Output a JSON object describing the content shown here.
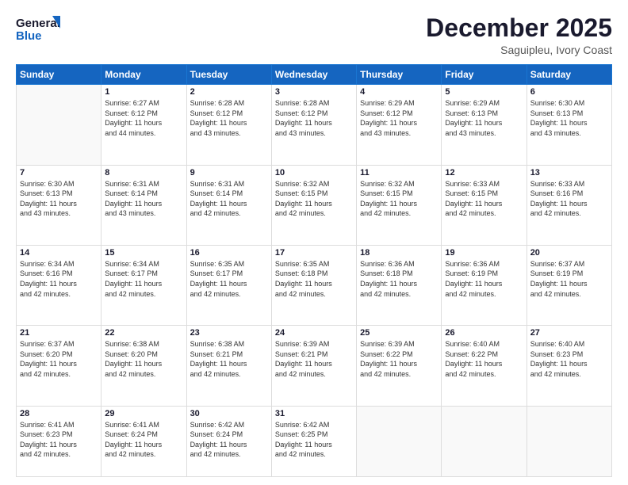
{
  "header": {
    "logo_general": "General",
    "logo_blue": "Blue",
    "month_year": "December 2025",
    "location": "Saguipleu, Ivory Coast"
  },
  "weekdays": [
    "Sunday",
    "Monday",
    "Tuesday",
    "Wednesday",
    "Thursday",
    "Friday",
    "Saturday"
  ],
  "weeks": [
    [
      {
        "day": "",
        "detail": ""
      },
      {
        "day": "1",
        "detail": "Sunrise: 6:27 AM\nSunset: 6:12 PM\nDaylight: 11 hours\nand 44 minutes."
      },
      {
        "day": "2",
        "detail": "Sunrise: 6:28 AM\nSunset: 6:12 PM\nDaylight: 11 hours\nand 43 minutes."
      },
      {
        "day": "3",
        "detail": "Sunrise: 6:28 AM\nSunset: 6:12 PM\nDaylight: 11 hours\nand 43 minutes."
      },
      {
        "day": "4",
        "detail": "Sunrise: 6:29 AM\nSunset: 6:12 PM\nDaylight: 11 hours\nand 43 minutes."
      },
      {
        "day": "5",
        "detail": "Sunrise: 6:29 AM\nSunset: 6:13 PM\nDaylight: 11 hours\nand 43 minutes."
      },
      {
        "day": "6",
        "detail": "Sunrise: 6:30 AM\nSunset: 6:13 PM\nDaylight: 11 hours\nand 43 minutes."
      }
    ],
    [
      {
        "day": "7",
        "detail": "Sunrise: 6:30 AM\nSunset: 6:13 PM\nDaylight: 11 hours\nand 43 minutes."
      },
      {
        "day": "8",
        "detail": "Sunrise: 6:31 AM\nSunset: 6:14 PM\nDaylight: 11 hours\nand 43 minutes."
      },
      {
        "day": "9",
        "detail": "Sunrise: 6:31 AM\nSunset: 6:14 PM\nDaylight: 11 hours\nand 42 minutes."
      },
      {
        "day": "10",
        "detail": "Sunrise: 6:32 AM\nSunset: 6:15 PM\nDaylight: 11 hours\nand 42 minutes."
      },
      {
        "day": "11",
        "detail": "Sunrise: 6:32 AM\nSunset: 6:15 PM\nDaylight: 11 hours\nand 42 minutes."
      },
      {
        "day": "12",
        "detail": "Sunrise: 6:33 AM\nSunset: 6:15 PM\nDaylight: 11 hours\nand 42 minutes."
      },
      {
        "day": "13",
        "detail": "Sunrise: 6:33 AM\nSunset: 6:16 PM\nDaylight: 11 hours\nand 42 minutes."
      }
    ],
    [
      {
        "day": "14",
        "detail": "Sunrise: 6:34 AM\nSunset: 6:16 PM\nDaylight: 11 hours\nand 42 minutes."
      },
      {
        "day": "15",
        "detail": "Sunrise: 6:34 AM\nSunset: 6:17 PM\nDaylight: 11 hours\nand 42 minutes."
      },
      {
        "day": "16",
        "detail": "Sunrise: 6:35 AM\nSunset: 6:17 PM\nDaylight: 11 hours\nand 42 minutes."
      },
      {
        "day": "17",
        "detail": "Sunrise: 6:35 AM\nSunset: 6:18 PM\nDaylight: 11 hours\nand 42 minutes."
      },
      {
        "day": "18",
        "detail": "Sunrise: 6:36 AM\nSunset: 6:18 PM\nDaylight: 11 hours\nand 42 minutes."
      },
      {
        "day": "19",
        "detail": "Sunrise: 6:36 AM\nSunset: 6:19 PM\nDaylight: 11 hours\nand 42 minutes."
      },
      {
        "day": "20",
        "detail": "Sunrise: 6:37 AM\nSunset: 6:19 PM\nDaylight: 11 hours\nand 42 minutes."
      }
    ],
    [
      {
        "day": "21",
        "detail": "Sunrise: 6:37 AM\nSunset: 6:20 PM\nDaylight: 11 hours\nand 42 minutes."
      },
      {
        "day": "22",
        "detail": "Sunrise: 6:38 AM\nSunset: 6:20 PM\nDaylight: 11 hours\nand 42 minutes."
      },
      {
        "day": "23",
        "detail": "Sunrise: 6:38 AM\nSunset: 6:21 PM\nDaylight: 11 hours\nand 42 minutes."
      },
      {
        "day": "24",
        "detail": "Sunrise: 6:39 AM\nSunset: 6:21 PM\nDaylight: 11 hours\nand 42 minutes."
      },
      {
        "day": "25",
        "detail": "Sunrise: 6:39 AM\nSunset: 6:22 PM\nDaylight: 11 hours\nand 42 minutes."
      },
      {
        "day": "26",
        "detail": "Sunrise: 6:40 AM\nSunset: 6:22 PM\nDaylight: 11 hours\nand 42 minutes."
      },
      {
        "day": "27",
        "detail": "Sunrise: 6:40 AM\nSunset: 6:23 PM\nDaylight: 11 hours\nand 42 minutes."
      }
    ],
    [
      {
        "day": "28",
        "detail": "Sunrise: 6:41 AM\nSunset: 6:23 PM\nDaylight: 11 hours\nand 42 minutes."
      },
      {
        "day": "29",
        "detail": "Sunrise: 6:41 AM\nSunset: 6:24 PM\nDaylight: 11 hours\nand 42 minutes."
      },
      {
        "day": "30",
        "detail": "Sunrise: 6:42 AM\nSunset: 6:24 PM\nDaylight: 11 hours\nand 42 minutes."
      },
      {
        "day": "31",
        "detail": "Sunrise: 6:42 AM\nSunset: 6:25 PM\nDaylight: 11 hours\nand 42 minutes."
      },
      {
        "day": "",
        "detail": ""
      },
      {
        "day": "",
        "detail": ""
      },
      {
        "day": "",
        "detail": ""
      }
    ]
  ]
}
